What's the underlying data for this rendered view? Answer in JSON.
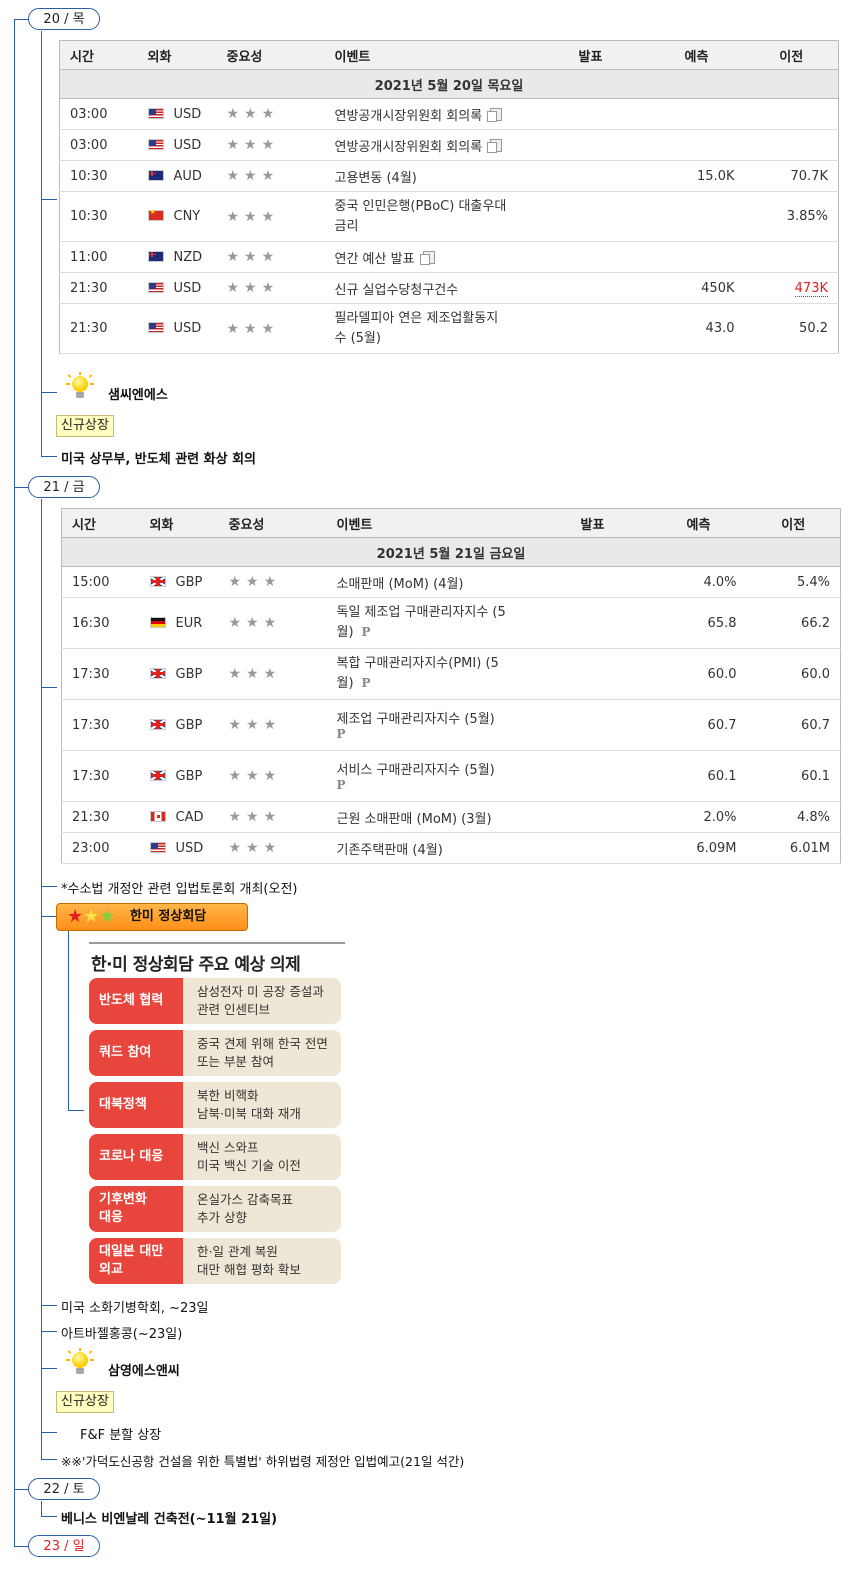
{
  "days": [
    {
      "label": "20 / 목"
    },
    {
      "label": "21 / 금"
    },
    {
      "label": "22 / 토"
    },
    {
      "label": "23 / 일"
    }
  ],
  "table_headers": [
    "시간",
    "외화",
    "중요성",
    "이벤트",
    "발표",
    "예측",
    "이전"
  ],
  "table1": {
    "date": "2021년 5월 20일 목요일",
    "rows": [
      {
        "time": "03:00",
        "cur": "USD",
        "event": "연방공개시장위원회 회의록",
        "actual": "",
        "forecast": "",
        "prev": ""
      },
      {
        "time": "03:00",
        "cur": "USD",
        "event": "연방공개시장위원회 회의록",
        "actual": "",
        "forecast": "",
        "prev": ""
      },
      {
        "time": "10:30",
        "cur": "AUD",
        "event": "고용변동 (4월)",
        "actual": "",
        "forecast": "15.0K",
        "prev": "70.7K"
      },
      {
        "time": "10:30",
        "cur": "CNY",
        "event": "중국 인민은행(PBoC) 대출우대\n금리",
        "actual": "",
        "forecast": "",
        "prev": "3.85%"
      },
      {
        "time": "11:00",
        "cur": "NZD",
        "event": "연간 예산 발표",
        "actual": "",
        "forecast": "",
        "prev": ""
      },
      {
        "time": "21:30",
        "cur": "USD",
        "event": "신규 실업수당청구건수",
        "actual": "",
        "forecast": "450K",
        "prev": "473K"
      },
      {
        "time": "21:30",
        "cur": "USD",
        "event": "필라델피아 연은 제조업활동지\n수 (5월)",
        "actual": "",
        "forecast": "43.0",
        "prev": "50.2"
      }
    ]
  },
  "day1_notes": {
    "company": "샘씨엔에스",
    "listing_tag": "신규상장",
    "note": "미국 상무부, 반도체 관련 화상 회의"
  },
  "table2": {
    "date": "2021년 5월 21일 금요일",
    "rows": [
      {
        "time": "15:00",
        "cur": "GBP",
        "event": "소매판매 (MoM) (4월)",
        "actual": "",
        "forecast": "4.0%",
        "prev": "5.4%"
      },
      {
        "time": "16:30",
        "cur": "EUR",
        "event": "독일 제조업 구매관리자지수 (5\n월)",
        "actual": "",
        "forecast": "65.8",
        "prev": "66.2"
      },
      {
        "time": "17:30",
        "cur": "GBP",
        "event": "복합 구매관리자지수(PMI) (5\n월)",
        "actual": "",
        "forecast": "60.0",
        "prev": "60.0"
      },
      {
        "time": "17:30",
        "cur": "GBP",
        "event": "제조업 구매관리자지수 (5월)",
        "actual": "",
        "forecast": "60.7",
        "prev": "60.7"
      },
      {
        "time": "17:30",
        "cur": "GBP",
        "event": "서비스 구매관리자지수 (5월)",
        "actual": "",
        "forecast": "60.1",
        "prev": "60.1"
      },
      {
        "time": "21:30",
        "cur": "CAD",
        "event": "근원 소매판매 (MoM) (3월)",
        "actual": "",
        "forecast": "2.0%",
        "prev": "4.8%"
      },
      {
        "time": "23:00",
        "cur": "USD",
        "event": "기존주택판매 (4월)",
        "actual": "",
        "forecast": "6.09M",
        "prev": "6.01M"
      }
    ],
    "prelim_mark": "P"
  },
  "day2_notes": {
    "note1": "*수소법 개정안 관련 입법토론회 개최(오전)",
    "summit_label": "한미 정상회담",
    "infographic": {
      "title": "한·미 정상회담 주요 예상 의제",
      "items": [
        {
          "label": "반도체 협력",
          "desc": "삼성전자 미 공장 증설과\n관련 인센티브"
        },
        {
          "label": "쿼드 참여",
          "desc": "중국 견제 위해 한국 전면\n또는 부분 참여"
        },
        {
          "label": "대북정책",
          "desc": "북한 비핵화\n남북·미북 대화 재개"
        },
        {
          "label": "코로나 대응",
          "desc": "백신 스와프\n미국 백신 기술 이전"
        },
        {
          "label": "기후변화\n대응",
          "desc": "온실가스 감축목표\n추가 상향"
        },
        {
          "label": "대일본 대만\n외교",
          "desc": "한·일 관계 복원\n대만 해협 평화 확보"
        }
      ]
    },
    "note2": "미국 소화기병학회, ~23일",
    "note3": "아트바젤홍콩(~23일)",
    "company": "삼영에스앤씨",
    "listing_tag": "신규상장",
    "note4": "F&F 분할 상장",
    "note5": "※※'가덕도신공항 건설을 위한 특별법' 하위법령 제정안 입법예고(21일 석간)"
  },
  "day3_notes": {
    "note1": "베니스 비엔날레 건축전(~11월 21일)"
  },
  "colors": {
    "tree_line": "#2d5fa8",
    "sunday": "#e02020",
    "up_red": "#e02020"
  }
}
